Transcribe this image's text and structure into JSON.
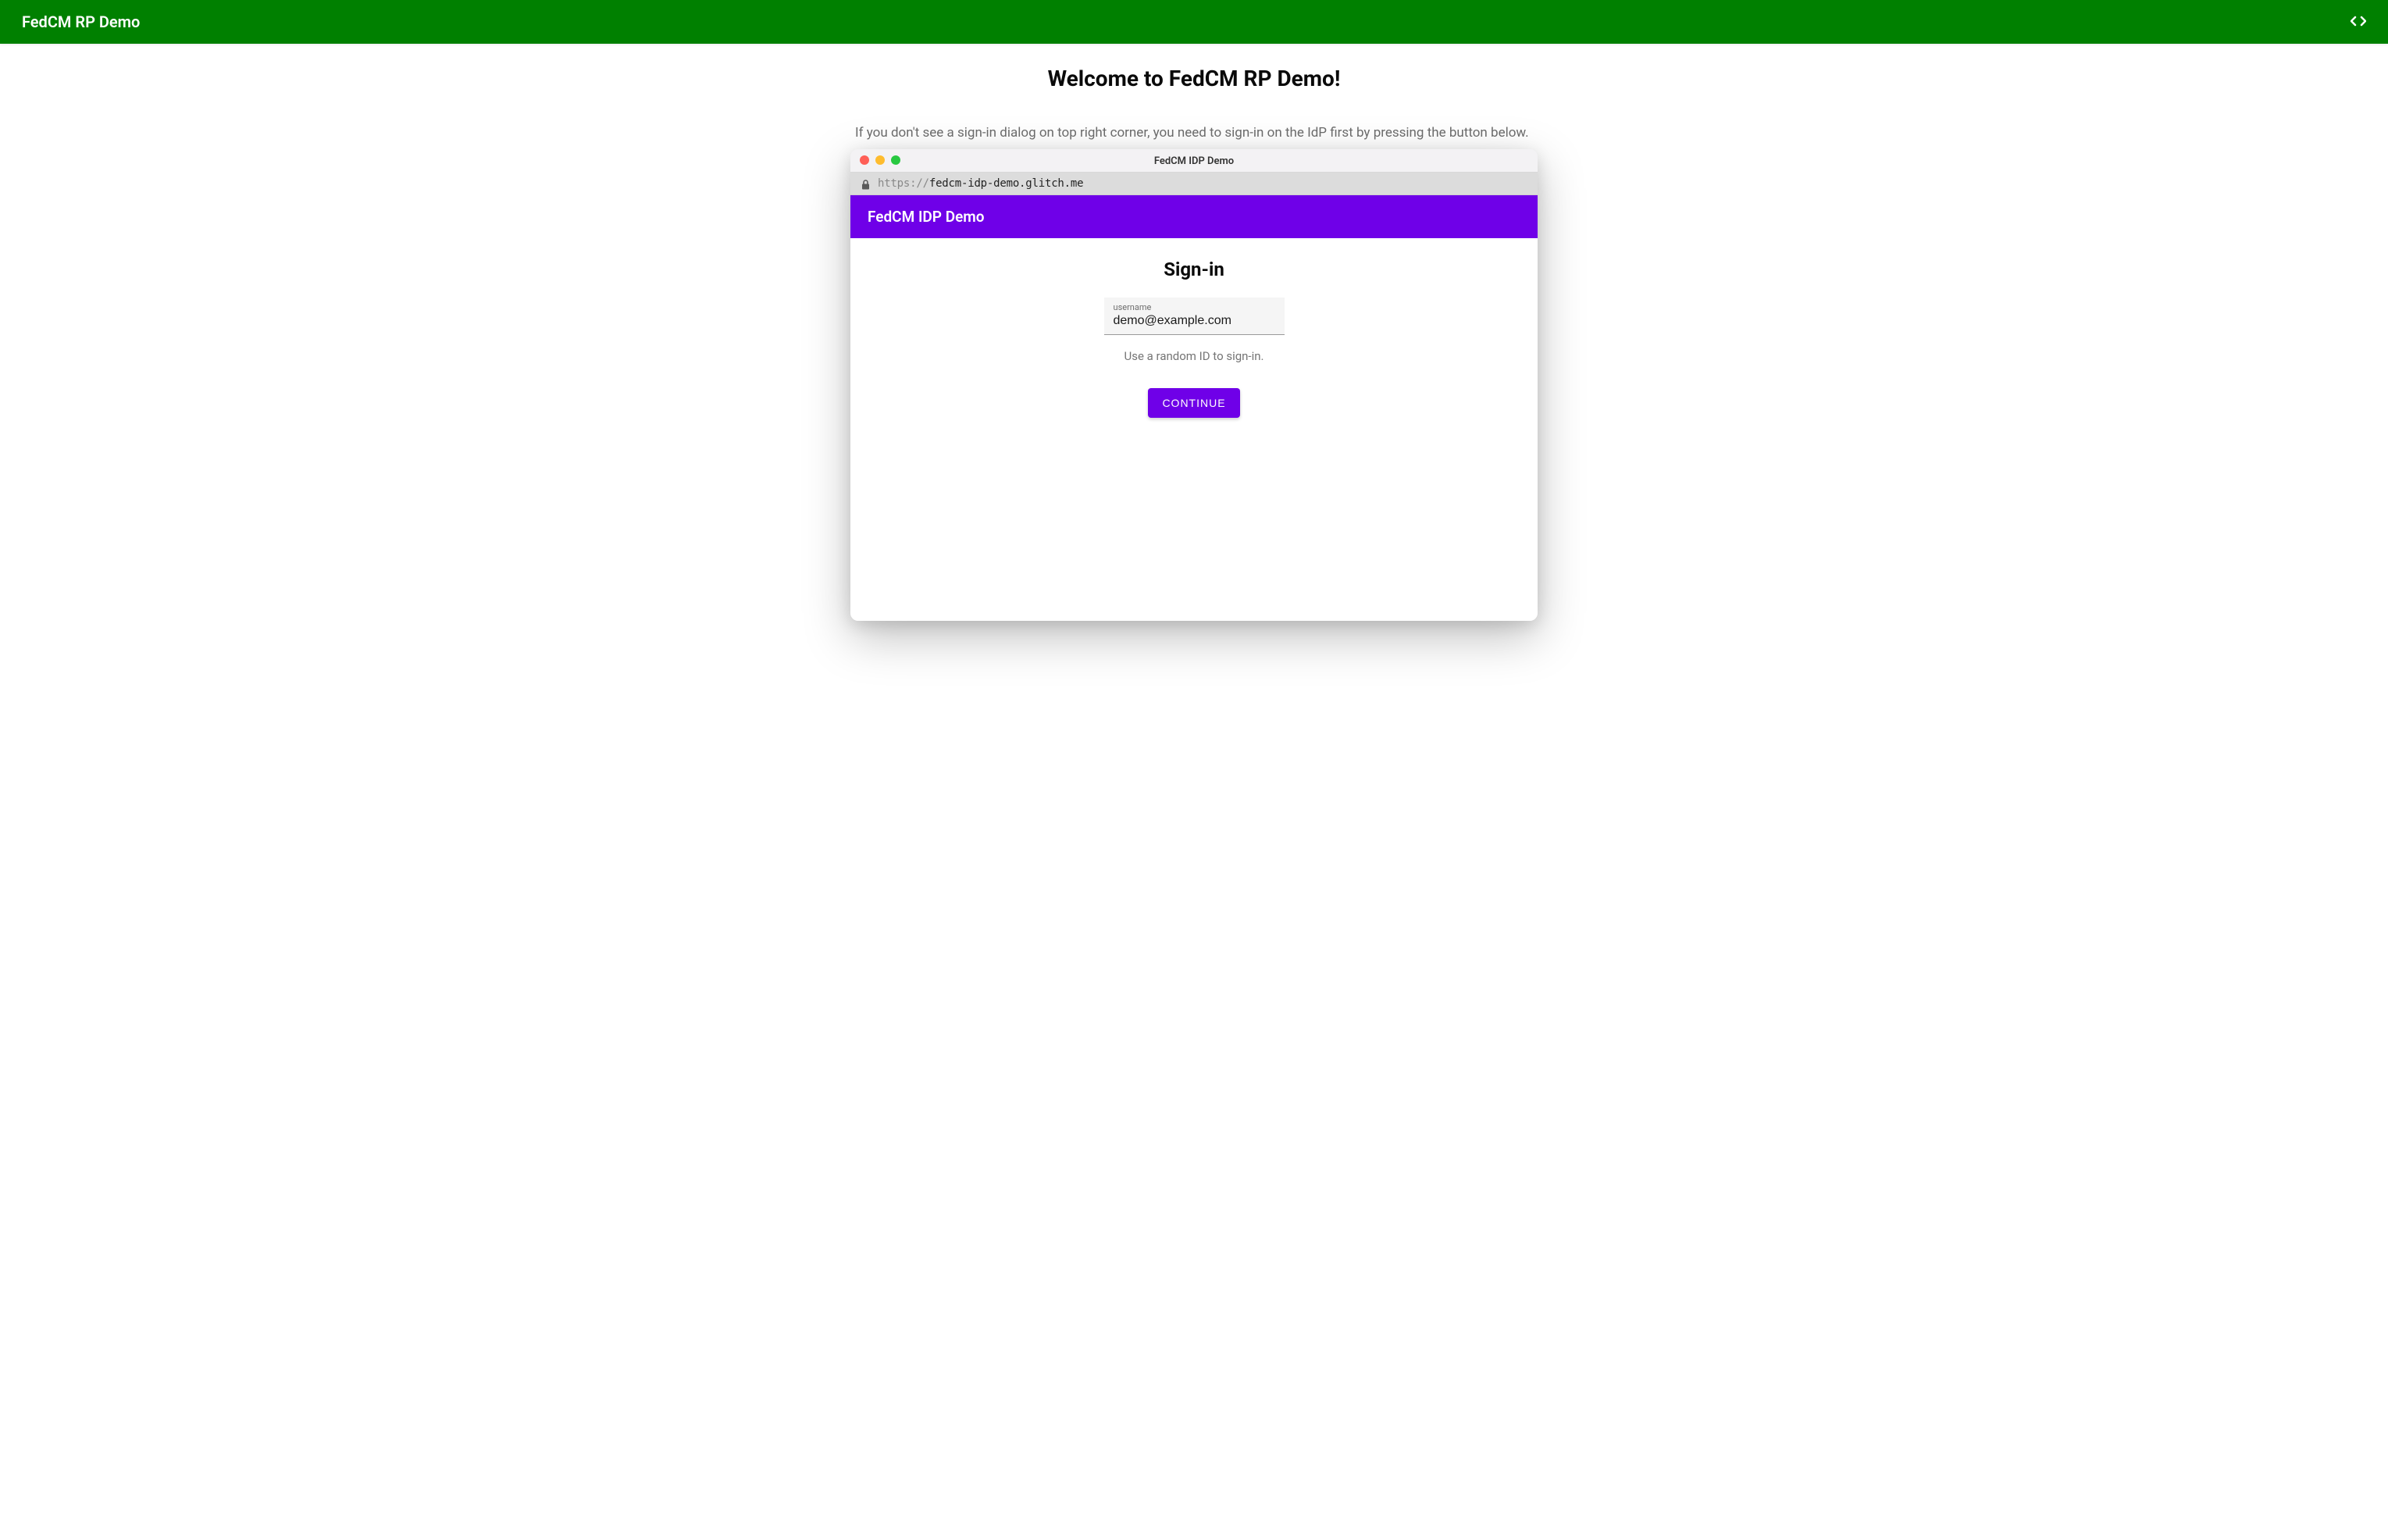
{
  "header": {
    "title": "FedCM RP Demo"
  },
  "main": {
    "heading": "Welcome to FedCM RP Demo!",
    "helper_text": "If you don't see a sign-in dialog on top right corner, you need to sign-in on the IdP first by pressing the button below."
  },
  "popup": {
    "window_title": "FedCM IDP Demo",
    "url_scheme": "https://",
    "url_host": "fedcm-idp-demo.glitch.me",
    "idp_header": "FedCM IDP Demo",
    "signin_heading": "Sign-in",
    "username_label": "username",
    "username_value": "demo@example.com",
    "hint": "Use a random ID to sign-in.",
    "continue_label": "CONTINUE"
  },
  "colors": {
    "primary_green": "#008000",
    "primary_purple": "#6f00e8"
  }
}
